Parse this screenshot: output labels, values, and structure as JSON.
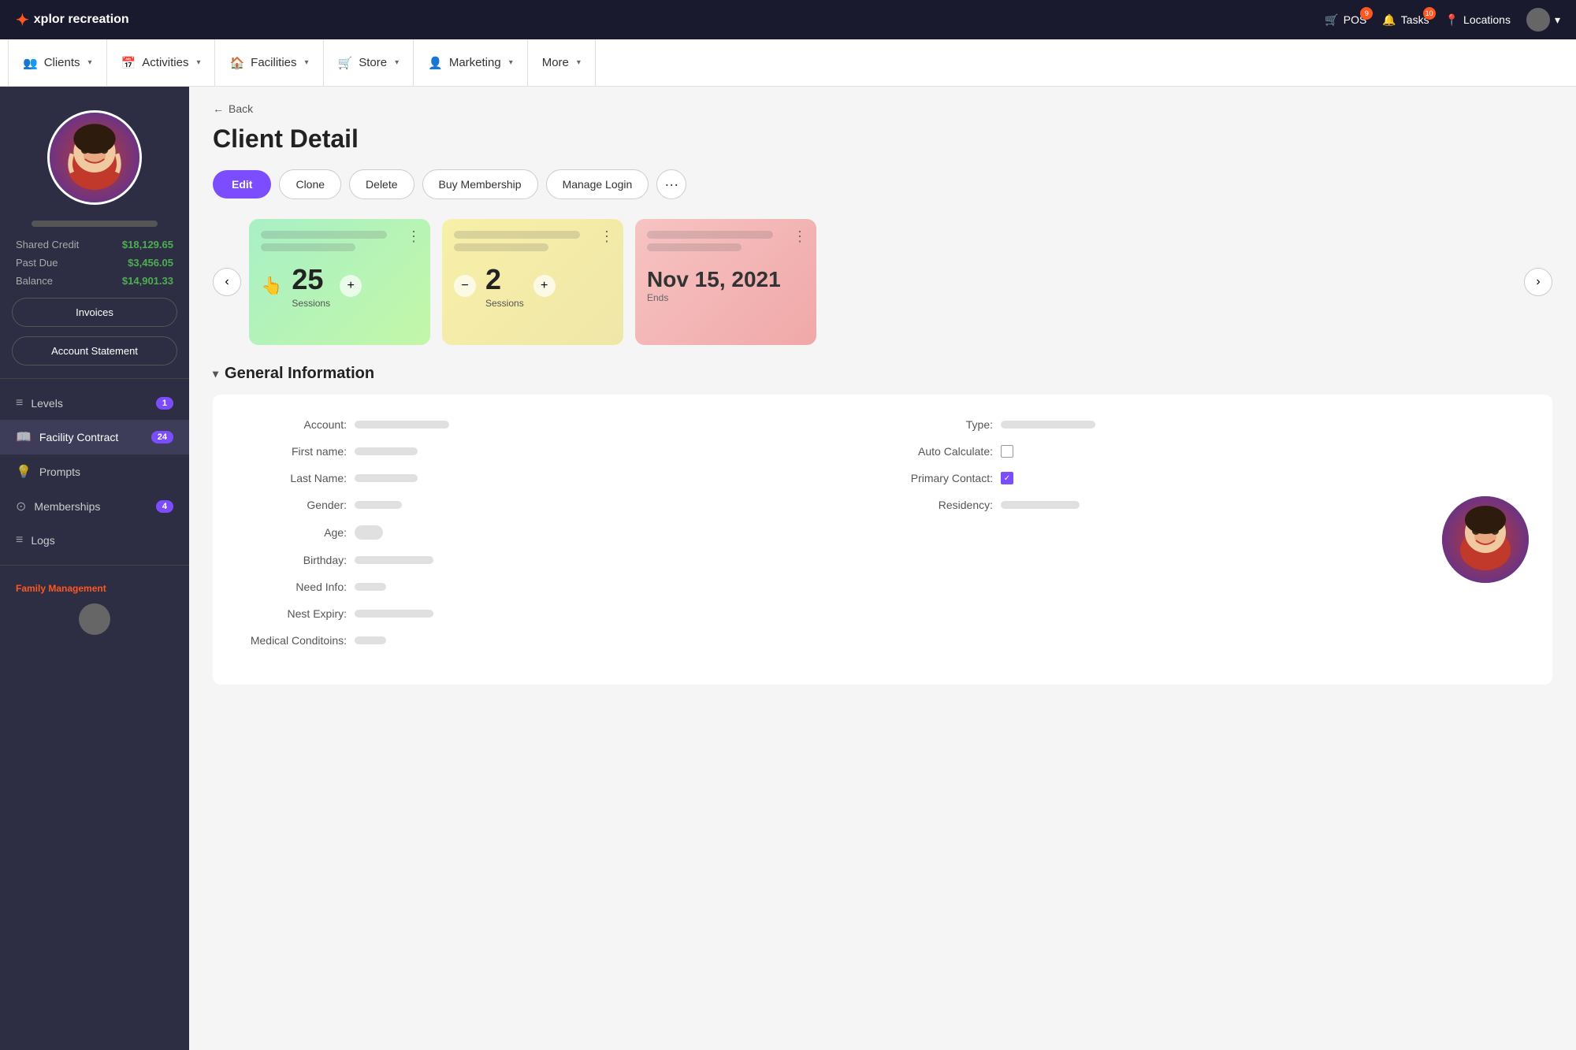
{
  "app": {
    "name": "xplor recreation",
    "logo_icon": "✦"
  },
  "top_nav": {
    "pos_label": "POS",
    "pos_badge": "9",
    "tasks_label": "Tasks",
    "tasks_badge": "10",
    "locations_label": "Locations"
  },
  "main_nav": {
    "items": [
      {
        "id": "clients",
        "label": "Clients",
        "icon": "👥"
      },
      {
        "id": "activities",
        "label": "Activities",
        "icon": "📅"
      },
      {
        "id": "facilities",
        "label": "Facilities",
        "icon": "🏠"
      },
      {
        "id": "store",
        "label": "Store",
        "icon": "🛒"
      },
      {
        "id": "marketing",
        "label": "Marketing",
        "icon": "👤"
      },
      {
        "id": "more",
        "label": "More",
        "icon": ""
      }
    ]
  },
  "sidebar": {
    "shared_credit_label": "Shared Credit",
    "shared_credit_value": "$18,129.65",
    "past_due_label": "Past Due",
    "past_due_value": "$3,456.05",
    "balance_label": "Balance",
    "balance_value": "$14,901.33",
    "invoices_btn": "Invoices",
    "account_statement_btn": "Account Statement",
    "menu_items": [
      {
        "id": "levels",
        "label": "Levels",
        "icon": "≡",
        "badge": "1"
      },
      {
        "id": "facility-contract",
        "label": "Facility Contract",
        "icon": "📖",
        "badge": "24"
      },
      {
        "id": "prompts",
        "label": "Prompts",
        "icon": "💡",
        "badge": ""
      },
      {
        "id": "memberships",
        "label": "Memberships",
        "icon": "⊙",
        "badge": "4"
      },
      {
        "id": "logs",
        "label": "Logs",
        "icon": "≡",
        "badge": ""
      }
    ],
    "family_section_label": "Family Management"
  },
  "content": {
    "back_label": "Back",
    "page_title": "Client Detail",
    "buttons": {
      "edit": "Edit",
      "clone": "Clone",
      "delete": "Delete",
      "buy_membership": "Buy Membership",
      "manage_login": "Manage Login",
      "more": "···"
    },
    "cards": [
      {
        "id": "card1",
        "type": "green",
        "sessions": "25",
        "sessions_label": "Sessions",
        "has_add": true
      },
      {
        "id": "card2",
        "type": "yellow",
        "sessions": "2",
        "sessions_label": "Sessions",
        "has_controls": true
      },
      {
        "id": "card3",
        "type": "red",
        "date": "Nov 15, 2021",
        "ends_label": "Ends"
      }
    ],
    "general_info": {
      "section_title": "General Information",
      "fields_left": [
        {
          "id": "account",
          "label": "Account:",
          "type": "text",
          "width": "w120"
        },
        {
          "id": "first_name",
          "label": "First name:",
          "type": "text",
          "width": "w80"
        },
        {
          "id": "last_name",
          "label": "Last Name:",
          "type": "text",
          "width": "w80"
        },
        {
          "id": "gender",
          "label": "Gender:",
          "type": "text",
          "width": "w60"
        },
        {
          "id": "age",
          "label": "Age:",
          "type": "toggle"
        },
        {
          "id": "birthday",
          "label": "Birthday:",
          "type": "text",
          "width": "w100"
        },
        {
          "id": "need_info",
          "label": "Need Info:",
          "type": "text",
          "width": "w40"
        },
        {
          "id": "nest_expiry",
          "label": "Nest Expiry:",
          "type": "text",
          "width": "w100"
        },
        {
          "id": "medical",
          "label": "Medical Conditoins:",
          "type": "text",
          "width": "w40"
        }
      ],
      "fields_right": [
        {
          "id": "type",
          "label": "Type:",
          "type": "text",
          "width": "w120"
        },
        {
          "id": "auto_calculate",
          "label": "Auto Calculate:",
          "type": "checkbox",
          "checked": false
        },
        {
          "id": "primary_contact",
          "label": "Primary Contact:",
          "type": "checkbox",
          "checked": true
        },
        {
          "id": "residency",
          "label": "Residency:",
          "type": "text",
          "width": "w100"
        }
      ]
    }
  }
}
